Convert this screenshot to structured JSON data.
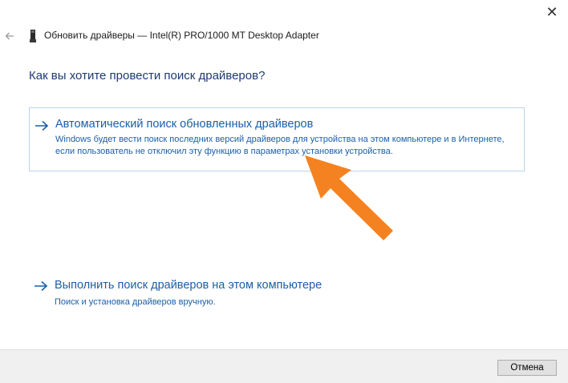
{
  "window": {
    "close_glyph": "✕",
    "title": "Обновить драйверы — Intel(R) PRO/1000 MT Desktop Adapter"
  },
  "main": {
    "question": "Как вы хотите провести поиск драйверов?",
    "options": [
      {
        "title": "Автоматический поиск обновленных драйверов",
        "description": "Windows будет вести поиск последних версий драйверов для устройства на этом компьютере и в Интернете, если пользователь не отключил эту функцию в параметрах установки устройства."
      },
      {
        "title": "Выполнить поиск драйверов на этом компьютере",
        "description": "Поиск и установка драйверов вручную."
      }
    ]
  },
  "footer": {
    "cancel_label": "Отмена"
  },
  "icons": {
    "back": "back-arrow-icon",
    "device": "network-adapter-icon",
    "option_arrow": "arrow-right-icon",
    "annotation": "orange-pointer-arrow-icon"
  },
  "colors": {
    "link": "#1a5fa8",
    "heading": "#1e3b70",
    "highlight_border": "#b9d3ec",
    "annotation": "#f58220",
    "footer_bg": "#f0f0f0"
  }
}
